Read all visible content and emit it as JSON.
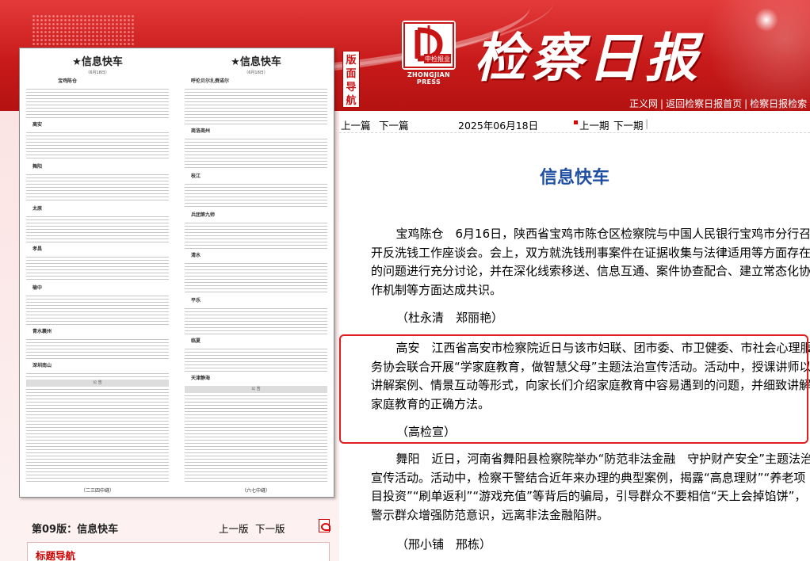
{
  "header": {
    "nav_badge": [
      "版",
      "面",
      "导",
      "航"
    ],
    "logo_text": "ZHONGJIAN PRESS",
    "logo_mark": "中检报业",
    "masthead": "检察日报",
    "links": [
      "正义网",
      "返回检察日报首页",
      "检察日报检索"
    ]
  },
  "left": {
    "scan": {
      "col1_head": "★信息快车",
      "col1_date": "（6月18日）",
      "col1_subs": [
        "宝鸡陈仓",
        "高安",
        "舞阳",
        "太原",
        "孝昌",
        "榆中",
        "青水襄州",
        "深圳南山"
      ],
      "col1_notice": "公 告",
      "col1_foot": "（二三四中缝）",
      "col2_head": "★信息快车",
      "col2_date": "（6月18日）",
      "col2_subs": [
        "呼伦贝尔扎赉诺尔",
        "商洛商州",
        "枝江",
        "兵团第九师",
        "清水",
        "平乐",
        "临夏",
        "天津静海"
      ],
      "col2_notice": "公 告",
      "col2_foot": "（六七中缝）"
    },
    "page_info": {
      "prefix": "第09版：",
      "name": "信息快车"
    },
    "prev_page": "上一版",
    "next_page": "下一版",
    "title_nav": "标题导航"
  },
  "toolbar": {
    "prev_article": "上一篇",
    "next_article": "下一篇",
    "date": "2025年06月18日",
    "prev_issue": "上一期",
    "next_issue": "下一期",
    "sep": "|"
  },
  "article": {
    "title": "信息快车",
    "p1": "宝鸡陈仓　6月16日，陕西省宝鸡市陈仓区检察院与中国人民银行宝鸡市分行召开反洗钱工作座谈会。会上，双方就洗钱刑事案件在证据收集与法律适用等方面存在的问题进行充分讨论，并在深化线索移送、信息互通、案件协查配合、建立常态化协作机制等方面达成共识。",
    "a1": "（杜永清　郑丽艳）",
    "p2": "高安　江西省高安市检察院近日与该市妇联、团市委、市卫健委、市社会心理服务协会联合开展“学家庭教育，做智慧父母”主题法治宣传活动。活动中，授课讲师以讲解案例、情景互动等形式，向家长们介绍家庭教育中容易遇到的问题，并细致讲解家庭教育的正确方法。",
    "a2": "（高检宣）",
    "p3": "舞阳　近日，河南省舞阳县检察院举办“防范非法金融　守护财产安全”主题法治宣传活动。活动中，检察干警结合近年来办理的典型案例，揭露“高息理财”“养老项目投资”“刷单返利”“游戏充值”等背后的骗局，引导群众不要相信“天上会掉馅饼”，警示群众增强防范意识，远离非法金融陷阱。",
    "a3": "（邢小铺　邢栋）"
  },
  "colors": {
    "title_blue": "#1f4fa3",
    "header_red": "#c81a1a",
    "highlight_red": "#e02020"
  }
}
